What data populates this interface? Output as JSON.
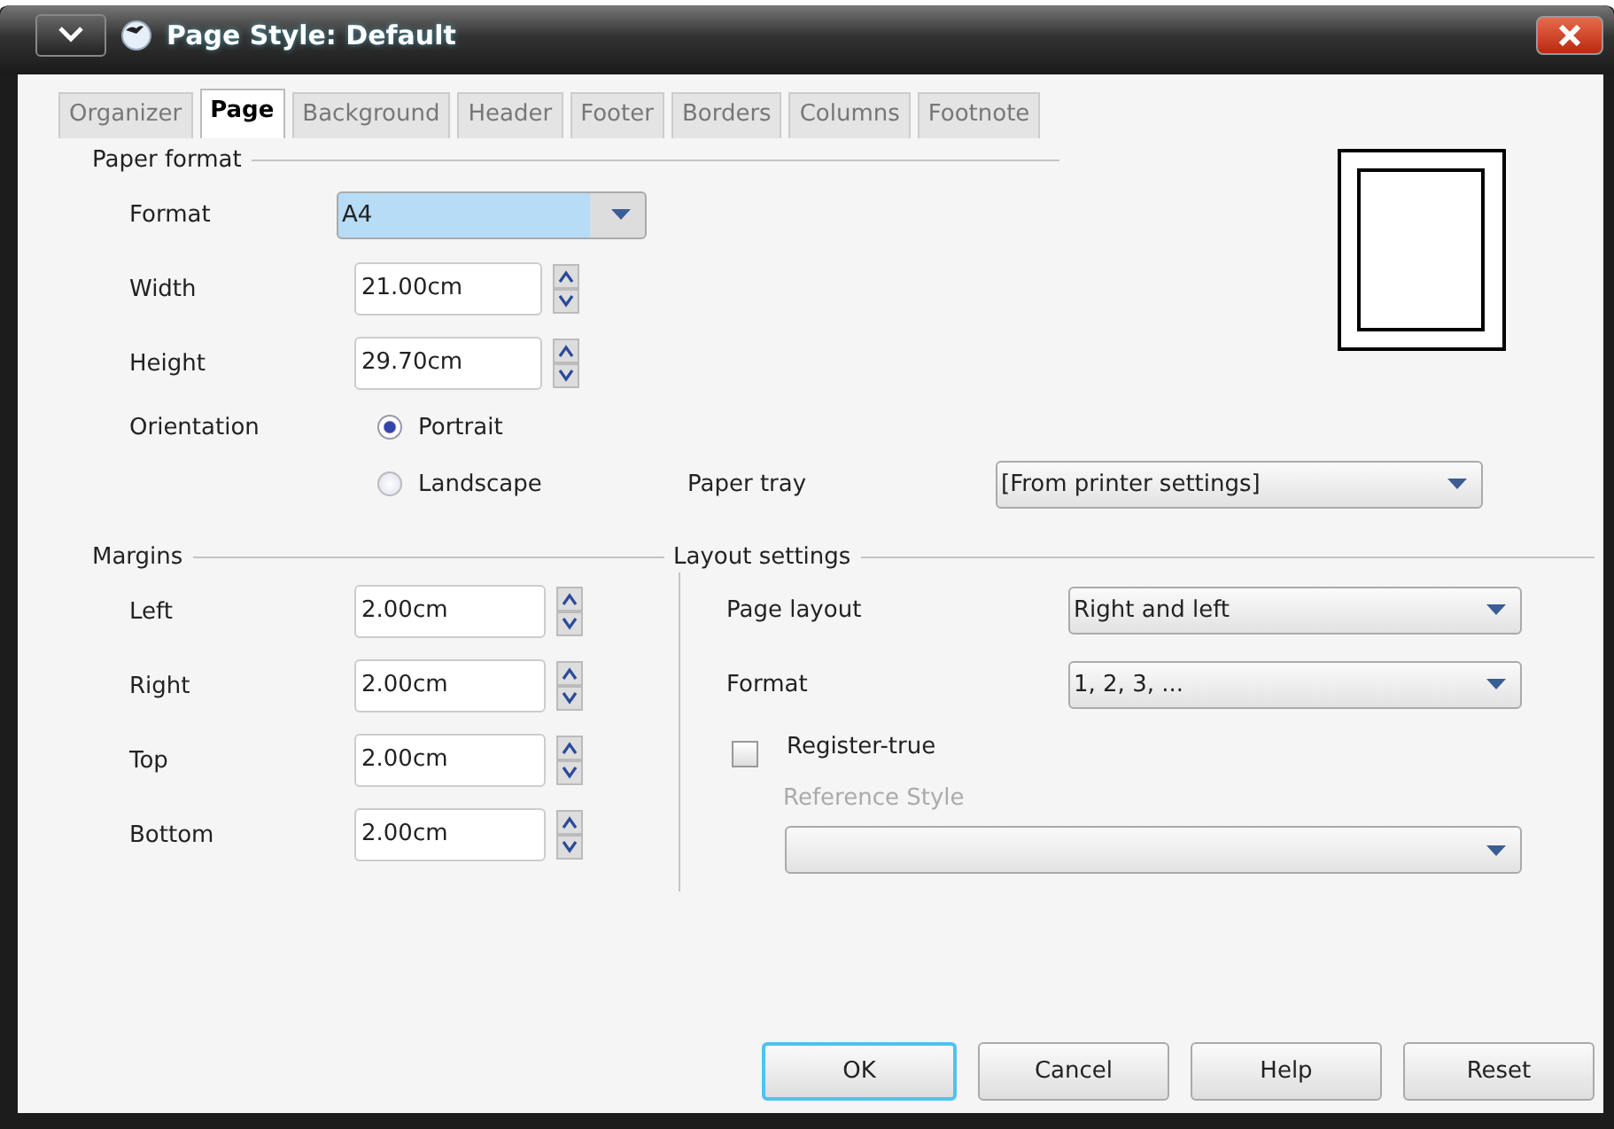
{
  "window": {
    "title": "Page Style: Default"
  },
  "tabs": [
    {
      "label": "Organizer",
      "selected": false
    },
    {
      "label": "Page",
      "selected": true
    },
    {
      "label": "Background",
      "selected": false
    },
    {
      "label": "Header",
      "selected": false
    },
    {
      "label": "Footer",
      "selected": false
    },
    {
      "label": "Borders",
      "selected": false
    },
    {
      "label": "Columns",
      "selected": false
    },
    {
      "label": "Footnote",
      "selected": false
    }
  ],
  "paper_format": {
    "title": "Paper format",
    "format": {
      "label": "Format",
      "value": "A4",
      "highlighted": true
    },
    "width": {
      "label": "Width",
      "value": "21.00cm"
    },
    "height": {
      "label": "Height",
      "value": "29.70cm"
    },
    "orientation": {
      "label": "Orientation",
      "options": [
        {
          "label": "Portrait",
          "selected": true
        },
        {
          "label": "Landscape",
          "selected": false
        }
      ]
    },
    "paper_tray": {
      "label": "Paper tray",
      "value": "[From printer settings]"
    }
  },
  "margins": {
    "title": "Margins",
    "fields": [
      {
        "label": "Left",
        "value": "2.00cm"
      },
      {
        "label": "Right",
        "value": "2.00cm"
      },
      {
        "label": "Top",
        "value": "2.00cm"
      },
      {
        "label": "Bottom",
        "value": "2.00cm"
      }
    ]
  },
  "layout_settings": {
    "title": "Layout settings",
    "page_layout": {
      "label": "Page layout",
      "value": "Right and left"
    },
    "format": {
      "label": "Format",
      "value": "1, 2, 3, ..."
    },
    "register_true": {
      "label": "Register-true",
      "checked": false
    },
    "reference_style": {
      "label": "Reference Style",
      "disabled": true
    }
  },
  "buttons": [
    {
      "label": "OK",
      "focused": true
    },
    {
      "label": "Cancel",
      "focused": false
    },
    {
      "label": "Help",
      "focused": false
    },
    {
      "label": "Reset",
      "focused": false
    }
  ]
}
